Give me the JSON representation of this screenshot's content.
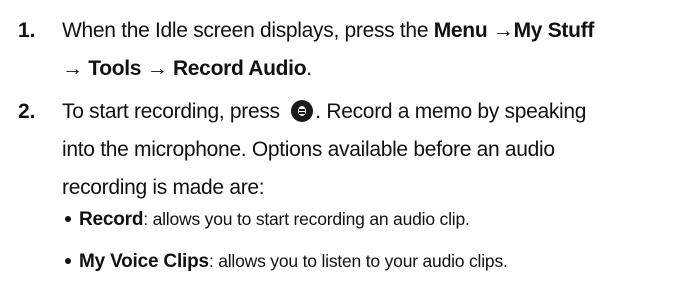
{
  "steps": [
    {
      "number": "1.",
      "line1_prefix": "When the Idle screen displays, press the ",
      "menu_path_1": "Menu →My Stuff",
      "line2_path": "→ Tools  → Record Audio",
      "line2_suffix": "."
    },
    {
      "number": "2.",
      "prefix": "To start recording, press ",
      "key_icon": "record-key-icon",
      "suffix_line1": ". Record a memo by speaking",
      "line2": "into the microphone. Options available before an audio",
      "line3": "recording is made are:"
    }
  ],
  "bullets": [
    {
      "term": "Record",
      "description": ": allows you to start recording an audio clip."
    },
    {
      "term": "My Voice Clips",
      "description": ": allows you to listen to your audio clips."
    }
  ]
}
